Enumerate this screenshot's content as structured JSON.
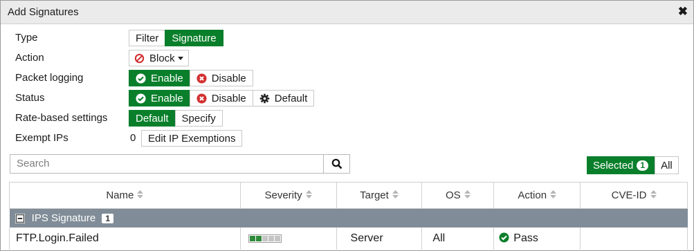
{
  "dialog": {
    "title": "Add Signatures"
  },
  "form": {
    "type": {
      "label": "Type",
      "options": [
        "Filter",
        "Signature"
      ],
      "selected": "Signature"
    },
    "action": {
      "label": "Action",
      "value": "Block"
    },
    "packet_logging": {
      "label": "Packet logging",
      "options": [
        "Enable",
        "Disable"
      ],
      "selected": "Enable"
    },
    "status": {
      "label": "Status",
      "options": [
        "Enable",
        "Disable",
        "Default"
      ],
      "selected": "Enable"
    },
    "rate_based": {
      "label": "Rate-based settings",
      "options": [
        "Default",
        "Specify"
      ],
      "selected": "Default"
    },
    "exempt_ips": {
      "label": "Exempt IPs",
      "count": "0",
      "button": "Edit IP Exemptions"
    }
  },
  "search": {
    "placeholder": "Search",
    "value": ""
  },
  "view_filter": {
    "selected_label": "Selected",
    "selected_count": "1",
    "all_label": "All",
    "active": "Selected"
  },
  "table": {
    "columns": [
      "Name",
      "Severity",
      "Target",
      "OS",
      "Action",
      "CVE-ID"
    ],
    "group": {
      "label": "IPS Signature",
      "count": "1"
    },
    "rows": [
      {
        "name": "FTP.Login.Failed",
        "severity_level": 2,
        "severity_max": 5,
        "target": "Server",
        "os": "All",
        "action": "Pass",
        "cve_id": ""
      }
    ]
  },
  "colors": {
    "accent_green": "#0a7f2b",
    "group_header": "#808d98",
    "titlebar": "#ebebeb"
  }
}
